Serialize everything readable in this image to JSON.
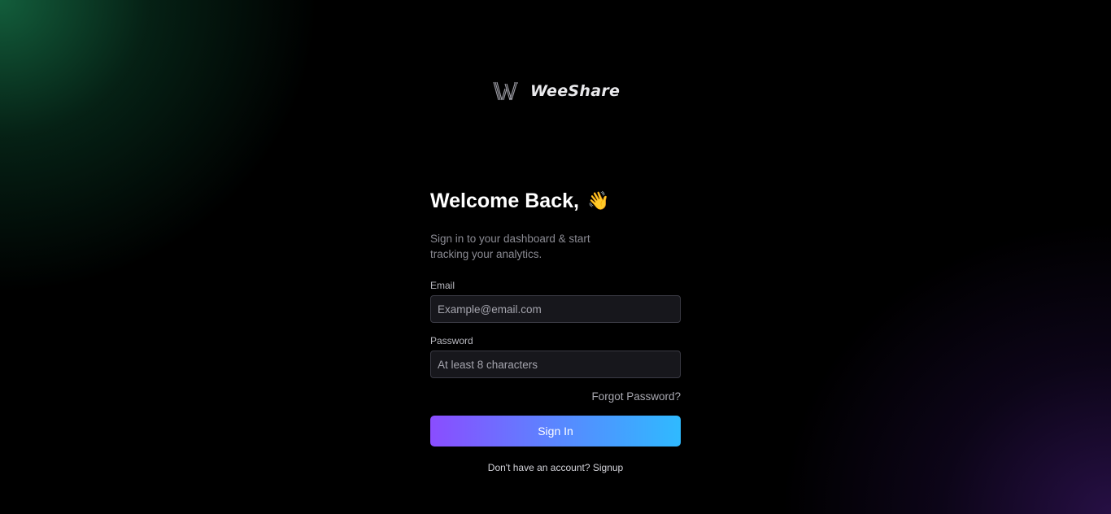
{
  "brand": {
    "name": "WeeShare",
    "logo_icon": "weeshare-w-logo-icon"
  },
  "login": {
    "title": "Welcome Back,",
    "title_emoji": "👋",
    "title_emoji_icon": "waving-hand-icon",
    "subtitle": "Sign in to your dashboard & start tracking your analytics.",
    "email_label": "Email",
    "email_value": "",
    "email_placeholder": "Example@email.com",
    "password_label": "Password",
    "password_value": "",
    "password_placeholder": "At least 8 characters",
    "forgot_password": "Forgot Password?",
    "sign_in_label": "Sign In",
    "no_account_text": "Don't have an account?",
    "signup_link": "Signup"
  },
  "colors": {
    "background": "#000000",
    "input_background": "#17171c",
    "button_gradient_start": "#8a4dff",
    "button_gradient_end": "#2fbaff",
    "glow_top_left": "#166e46",
    "glow_bottom_right": "#2d1250"
  }
}
